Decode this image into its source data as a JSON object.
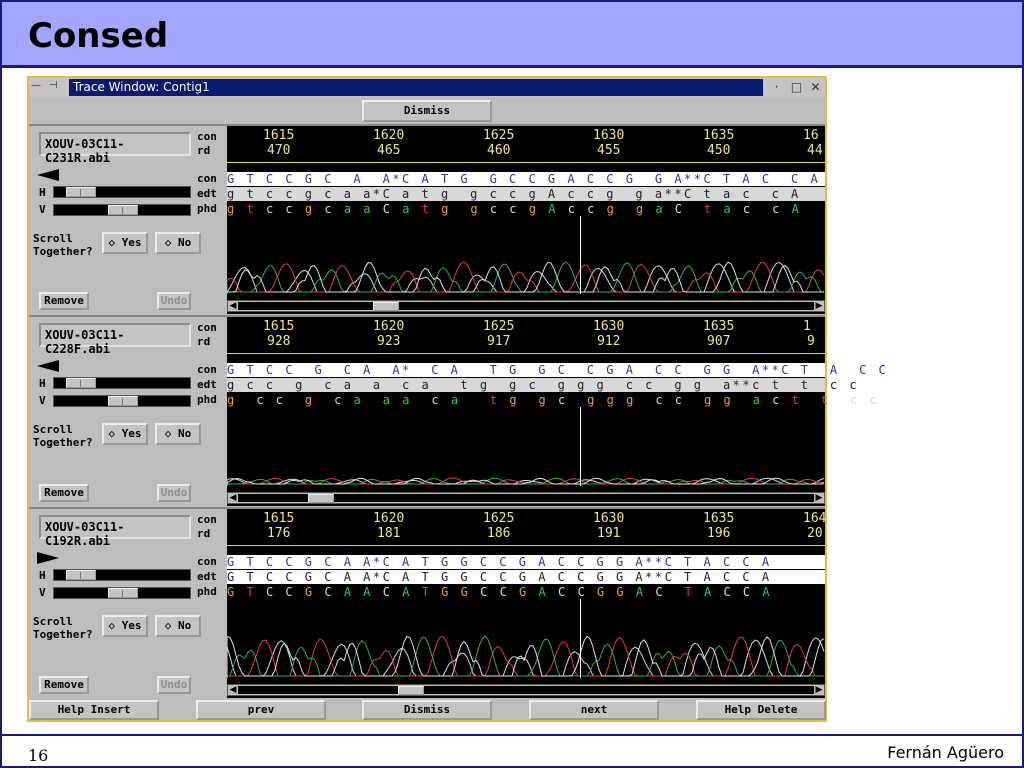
{
  "slide": {
    "title": "Consed",
    "page_number": "16",
    "author": "Fernán Agüero"
  },
  "window": {
    "title": "Trace Window: Contig1",
    "dismiss_top": "Dismiss"
  },
  "labels": {
    "con": "con",
    "rd": "rd",
    "edt": "edt",
    "phd": "phd",
    "h": "H",
    "v": "V",
    "scroll1": "Scroll",
    "scroll2": "Together?",
    "yes": "Yes",
    "no": "No",
    "remove": "Remove",
    "undo": "Undo"
  },
  "panes": [
    {
      "file": "XOUV-03C11-C231R.abi",
      "con_pos": [
        "1615",
        "1620",
        "1625",
        "1630",
        "1635",
        "16"
      ],
      "rd_pos": [
        "470",
        "465",
        "460",
        "455",
        "450",
        "44"
      ],
      "con_seq": "G T C C G C  A  A*C A T G  G C C G A C C G  G A**C T A C  C A",
      "edt_seq": "g t c c g c a a*C a t g  g c c g A c c g  g a**C t a c  c A",
      "phd_seq": "g t c c g c a a C a t g  g c c g A c c g  g a C  t a c  c A"
    },
    {
      "file": "XOUV-03C11-C228F.abi",
      "con_pos": [
        "1615",
        "1620",
        "1625",
        "1630",
        "1635",
        "1"
      ],
      "rd_pos": [
        "928",
        "923",
        "917",
        "912",
        "907",
        "9"
      ],
      "con_seq": "G T C C  G  C A  A*  C A   T G  G C  C G A  C C  G G  A**C T  A  C C",
      "edt_seq": "g c c  g  c a  a  c a   t g  g c  g g g  c c  g g  a**c t  t  c c",
      "phd_seq": "g  c c  g  c a  a a  c a   t g  g c  g g g  c c  g g  a c t  t  c c"
    },
    {
      "file": "XOUV-03C11-C192R.abi",
      "con_pos": [
        "1615",
        "1620",
        "1625",
        "1630",
        "1635",
        "164"
      ],
      "rd_pos": [
        "176",
        "181",
        "186",
        "191",
        "196",
        "20"
      ],
      "con_seq": "G T C C G C A A*C A T G G C C G A C C G G A**C T A C C A",
      "edt_seq": "G T C C G C A A*C A T G G C C G A C C G G A**C T A C C A",
      "phd_seq": "G T C C G C A A C A T G G C C G A C C G G A C  T A C C A"
    }
  ],
  "bottom_buttons": {
    "help_insert": "Help Insert",
    "prev": "prev",
    "dismiss": "Dismiss",
    "next": "next",
    "help_delete": "Help Delete"
  }
}
